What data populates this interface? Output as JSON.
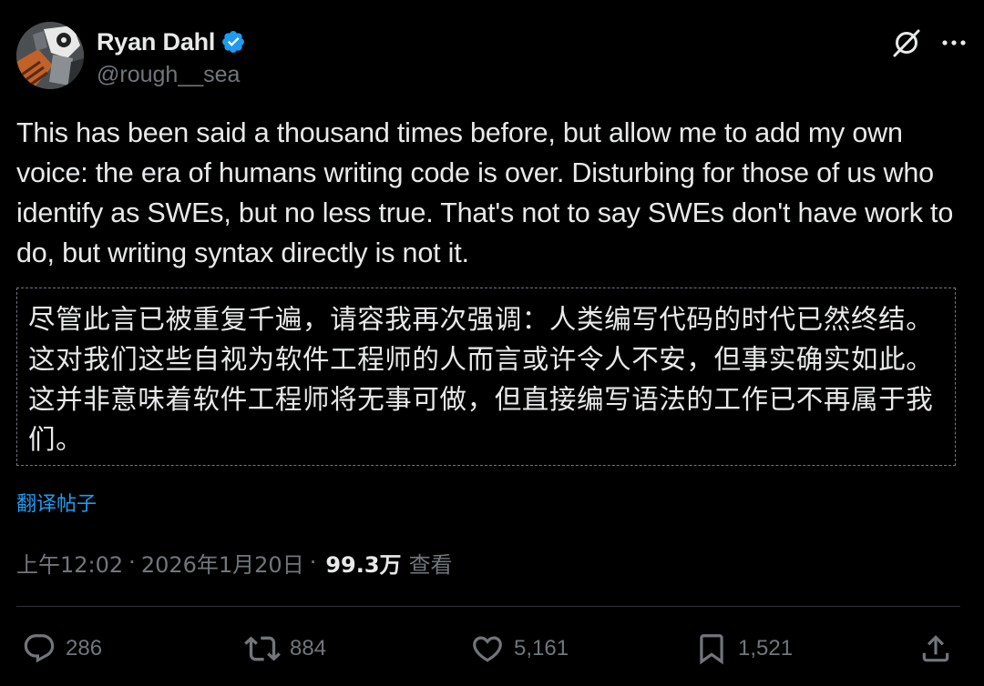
{
  "author": {
    "display_name": "Ryan Dahl",
    "handle": "@rough__sea",
    "verified": true,
    "avatar_icon": "avatar-illustration"
  },
  "header_icons": [
    "grok-icon",
    "more-icon"
  ],
  "post": {
    "text": "This has been said a thousand times before, but allow me to add my own voice: the era of humans writing code is over. Disturbing for those of us who identify as SWEs, but no less true. That's not to say SWEs don't have work to do, but writing syntax directly is not it."
  },
  "translation": {
    "text": "尽管此言已被重复千遍，请容我再次强调：人类编写代码的时代已然终结。这对我们这些自视为软件工程师的人而言或许令人不安，但事实确实如此。这并非意味着软件工程师将无事可做，但直接编写语法的工作已不再属于我们。",
    "link_label": "翻译帖子"
  },
  "meta": {
    "time": "上午12:02",
    "separator": "·",
    "date": "2026年1月20日",
    "views_count": "99.3万",
    "views_label": "查看"
  },
  "actions": {
    "replies": "286",
    "reposts": "884",
    "likes": "5,161",
    "bookmarks": "1,521"
  },
  "colors": {
    "background": "#000000",
    "text_primary": "#e7e9ea",
    "text_secondary": "#71767b",
    "link": "#1d9bf0",
    "verified_badge": "#1d9bf0",
    "divider": "#2f3336"
  }
}
